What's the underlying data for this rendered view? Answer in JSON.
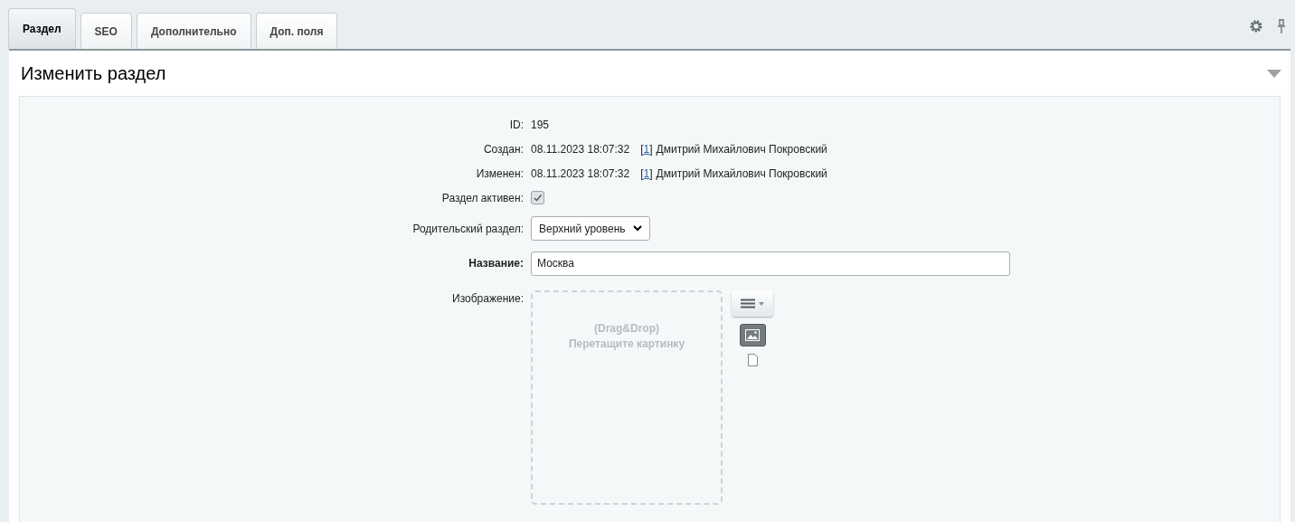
{
  "tabs": [
    {
      "label": "Раздел",
      "selected": true
    },
    {
      "label": "SEO",
      "selected": false
    },
    {
      "label": "Дополнительно",
      "selected": false
    },
    {
      "label": "Доп. поля",
      "selected": false
    }
  ],
  "section": {
    "title": "Изменить раздел",
    "expanded": true
  },
  "fields": [
    {
      "kind": "text",
      "label": "ID:",
      "value": "195"
    },
    {
      "kind": "meta",
      "label": "Создан:",
      "value": "08.11.2023 18:07:32",
      "open": "[",
      "user_id": "1",
      "close": "]",
      "user": "Дмитрий Михайлович Покровский"
    },
    {
      "kind": "meta",
      "label": "Изменен:",
      "value": "08.11.2023 18:07:32",
      "open": "[",
      "user_id": "1",
      "close": "]",
      "user": "Дмитрий Михайлович Покровский"
    },
    {
      "kind": "checkbox",
      "label": "Раздел активен:",
      "checked": true
    },
    {
      "kind": "select",
      "label": "Родительский раздел:",
      "value": "Верхний уровень"
    },
    {
      "kind": "input",
      "label": "Название:",
      "value": "Москва",
      "required": true
    },
    {
      "kind": "image",
      "label": "Изображение:",
      "drop_line1": "(Drag&Drop)",
      "drop_line2": "Перетащите картинку"
    }
  ]
}
